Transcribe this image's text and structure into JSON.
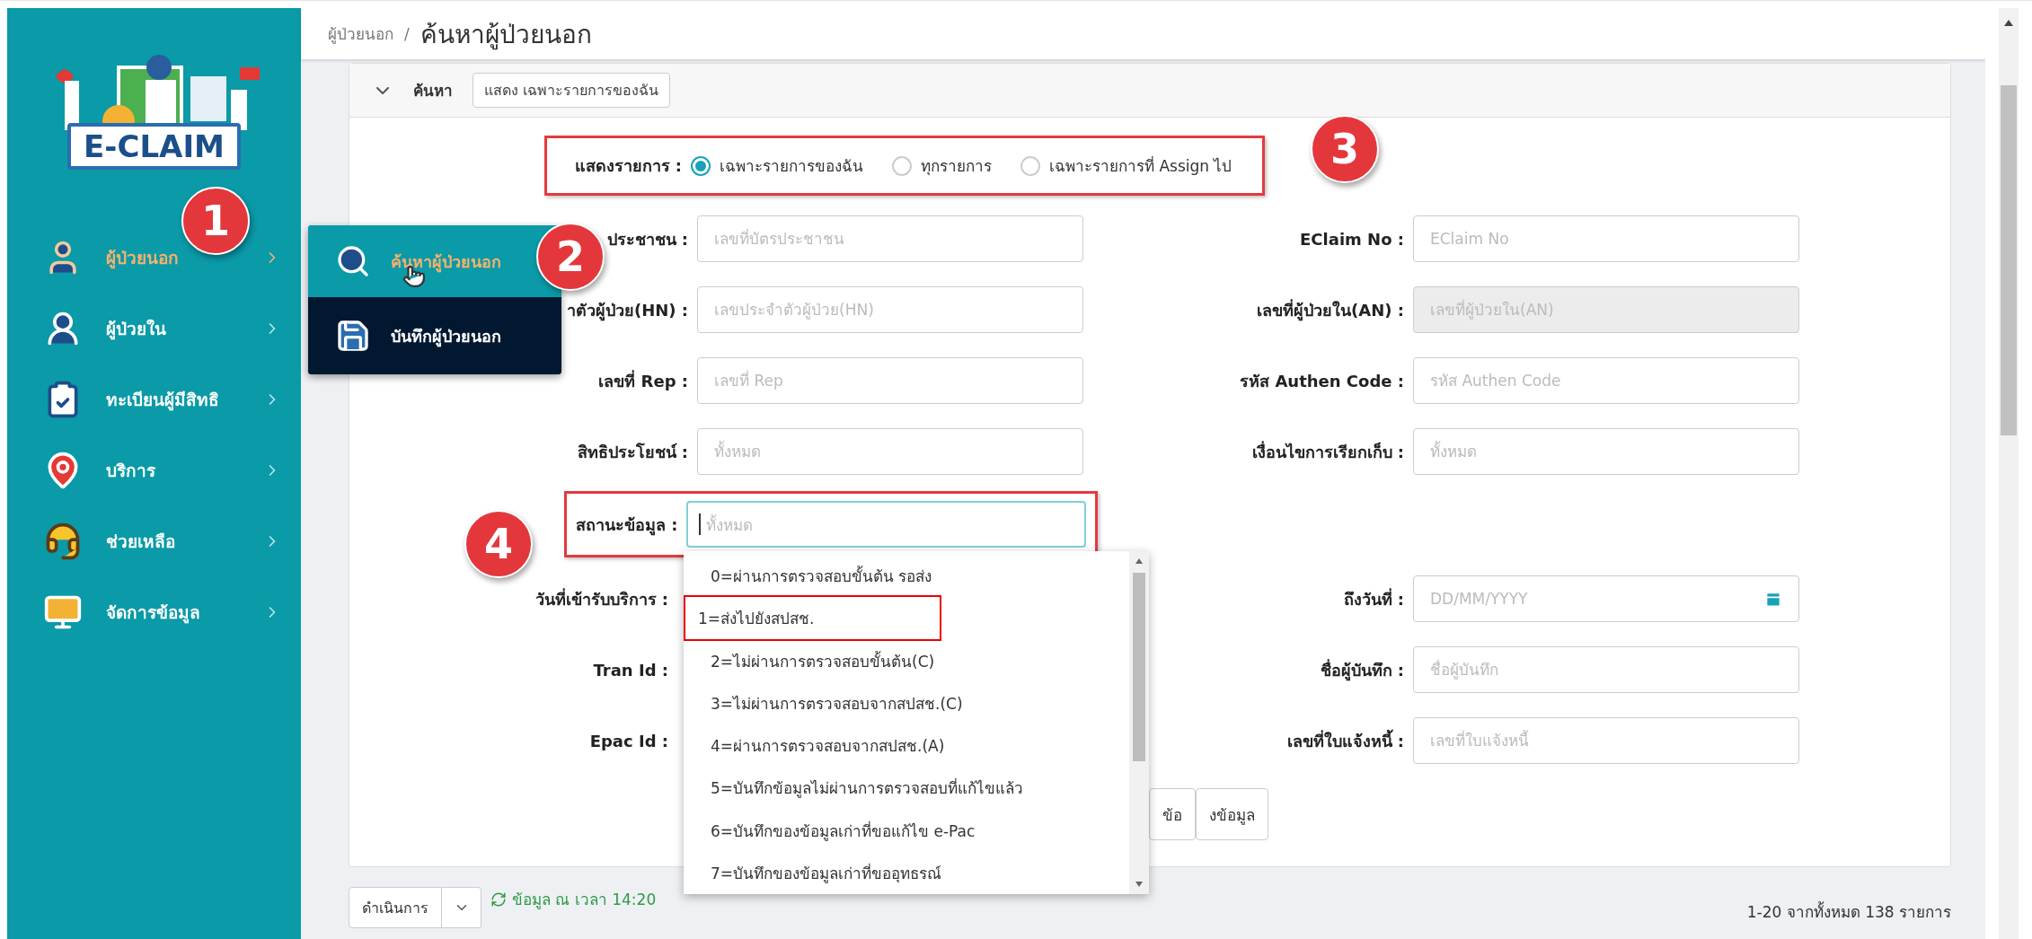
{
  "sidebar": {
    "logo_text": "E-CLAIM",
    "items": [
      {
        "label": "ผู้ป่วยนอก",
        "selected": true
      },
      {
        "label": "ผู้ป่วยใน",
        "selected": false
      },
      {
        "label": "ทะเบียนผู้มีสิทธิ",
        "selected": false
      },
      {
        "label": "บริการ",
        "selected": false
      },
      {
        "label": "ช่วยเหลือ",
        "selected": false
      },
      {
        "label": "จัดการข้อมูล",
        "selected": false
      }
    ]
  },
  "submenu": {
    "items": [
      {
        "label": "ค้นหาผู้ป่วยนอก",
        "selected": true
      },
      {
        "label": "บันทึกผู้ป่วยนอก",
        "selected": false
      }
    ]
  },
  "breadcrumb": {
    "parent": "ผู้ป่วยนอก",
    "separator": "/",
    "current": "ค้นหาผู้ป่วยนอก"
  },
  "search_panel": {
    "title": "ค้นหา",
    "expanded": true,
    "filter_tag": "แสดง เฉพาะรายการของฉัน",
    "show_list": {
      "label": "แสดงรายการ :",
      "options": [
        {
          "label": "เฉพาะรายการของฉัน",
          "selected": true
        },
        {
          "label": "ทุกรายการ",
          "selected": false
        },
        {
          "label": "เฉพาะรายการที่ Assign ไป",
          "selected": false
        }
      ]
    },
    "left_fields": [
      {
        "label": "ประชาชน :",
        "placeholder": "เลขที่บัตรประชาชน",
        "disabled": false
      },
      {
        "label": "าตัวผู้ป่วย(HN) :",
        "placeholder": "เลขประจำตัวผู้ป่วย(HN)",
        "disabled": false
      },
      {
        "label": "เลขที่ Rep :",
        "placeholder": "เลขที่ Rep",
        "disabled": false
      },
      {
        "label": "สิทธิประโยชน์ :",
        "placeholder": "ทั้งหมด",
        "disabled": false
      }
    ],
    "right_fields": [
      {
        "label": "EClaim No :",
        "placeholder": "EClaim No",
        "disabled": false
      },
      {
        "label": "เลขที่ผู้ป่วยใน(AN) :",
        "placeholder": "เลขที่ผู้ป่วยใน(AN)",
        "disabled": true
      },
      {
        "label": "รหัส Authen Code :",
        "placeholder": "รหัส Authen Code",
        "disabled": false
      },
      {
        "label": "เงื่อนไขการเรียกเก็บ :",
        "placeholder": "ทั้งหมด",
        "disabled": false
      }
    ],
    "status_field": {
      "label": "สถานะข้อมูล :",
      "placeholder": "ทั้งหมด",
      "expanded": true,
      "options": [
        {
          "label": "0=ผ่านการตรวจสอบขั้นต้น รอส่ง",
          "marked": false
        },
        {
          "label": "1=ส่งไปยังสปสช.",
          "marked": true
        },
        {
          "label": "2=ไม่ผ่านการตรวจสอบขั้นต้น(C)",
          "marked": false
        },
        {
          "label": "3=ไม่ผ่านการตรวจสอบจากสปสช.(C)",
          "marked": false
        },
        {
          "label": "4=ผ่านการตรวจสอบจากสปสช.(A)",
          "marked": false
        },
        {
          "label": "5=บันทึกข้อมูลไม่ผ่านการตรวจสอบที่แก้ไขแล้ว",
          "marked": false
        },
        {
          "label": "6=บันทึกของข้อมูลเก่าที่ขอแก้ไข e-Pac",
          "marked": false
        },
        {
          "label": "7=บันทึกของข้อมูลเก่าที่ขออุทธรณ์",
          "marked": false
        }
      ]
    },
    "lower_left_labels": [
      "วันที่เข้ารับบริการ :",
      "Tran Id :",
      "Epac Id :"
    ],
    "lower_right_fields": [
      {
        "label": "ถึงวันที่ :",
        "placeholder": "DD/MM/YYYY",
        "kind": "date"
      },
      {
        "label": "ชื่อผู้บันทึก :",
        "placeholder": "ชื่อผู้บันทึก",
        "kind": "text"
      },
      {
        "label": "เลขที่ใบแจ้งหนี้ :",
        "placeholder": "เลขที่ใบแจ้งหนี้",
        "kind": "text"
      }
    ],
    "buttons": [
      "ข้อ",
      "งข้อมูล"
    ]
  },
  "toolbar": {
    "action_button": "ดำเนินการ",
    "updated": "ข้อมูล ณ เวลา 14:20",
    "paging": "1-20 จากทั้งหมด 138 รายการ"
  },
  "annotations": [
    "1",
    "2",
    "3",
    "4"
  ]
}
